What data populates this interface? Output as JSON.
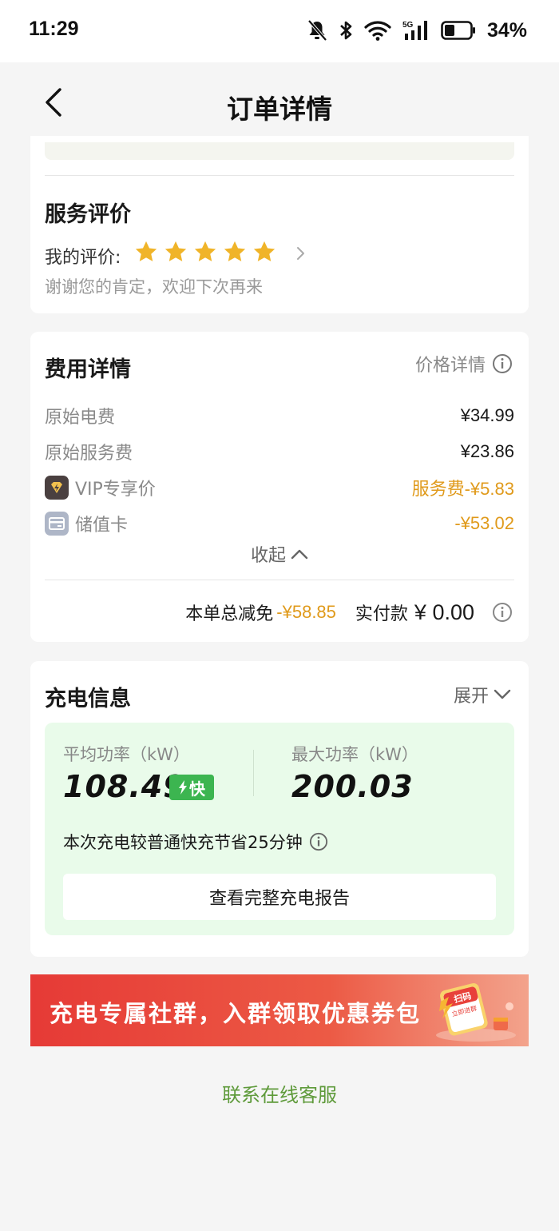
{
  "status_bar": {
    "time": "11:29",
    "battery": "34%",
    "network": "5G"
  },
  "nav": {
    "title": "订单详情"
  },
  "review": {
    "title": "服务评价",
    "my_rating_label": "我的评价:",
    "rating": 5,
    "rating_max": 5,
    "thanks": "谢谢您的肯定，欢迎下次再来"
  },
  "fees": {
    "title": "费用详情",
    "price_detail_link": "价格详情",
    "rows": [
      {
        "label": "原始电费",
        "value": "¥34.99",
        "icon": "",
        "highlight": false
      },
      {
        "label": "原始服务费",
        "value": "¥23.86",
        "icon": "",
        "highlight": false
      },
      {
        "label": "VIP专享价",
        "value": "服务费-¥5.83",
        "icon": "vip-lightning-icon",
        "highlight": true
      },
      {
        "label": "储值卡",
        "value": "-¥53.02",
        "icon": "card-icon",
        "highlight": true
      }
    ],
    "collapse": "收起",
    "total_discount_label": "本单总减免",
    "total_discount_value": "-¥58.85",
    "paid_label": "实付款",
    "paid_value": "¥ 0.00"
  },
  "charging": {
    "title": "充电信息",
    "expand": "展开",
    "avg_power_label": "平均功率（kW）",
    "avg_power_value": "108.49",
    "fast_badge": "快",
    "max_power_label": "最大功率（kW）",
    "max_power_value": "200.03",
    "saving_text": "本次充电较普通快充节省25分钟",
    "report_button": "查看完整充电报告"
  },
  "banner": {
    "text": "充电专属社群，入群领取优惠券包",
    "tag_top": "扫码",
    "tag_bottom": "立即进群"
  },
  "footer": {
    "service_link": "联系在线客服"
  },
  "colors": {
    "accent_orange": "#e09a1b",
    "star": "#f0b429",
    "green_badge": "#3cb550",
    "link_green": "#5e9a3a",
    "banner_red": "#e63a36"
  }
}
